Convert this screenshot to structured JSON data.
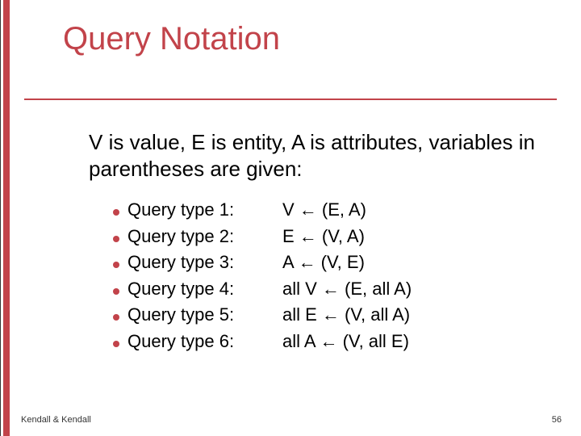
{
  "title": "Query Notation",
  "intro": "V is value, E is entity, A is attributes, variables in parentheses are given:",
  "items": [
    {
      "label": "Query type 1:",
      "expr": "V ← (E, A)"
    },
    {
      "label": "Query type 2:",
      "expr": "E ← (V, A)"
    },
    {
      "label": "Query type 3:",
      "expr": "A ← (V, E)"
    },
    {
      "label": "Query type 4:",
      "expr": "all V ← (E, all A)"
    },
    {
      "label": "Query type 5:",
      "expr": "all E ← (V, all A)"
    },
    {
      "label": "Query type 6:",
      "expr": "all A ← (V, all E)"
    }
  ],
  "footer": {
    "left": "Kendall & Kendall",
    "right": "56"
  },
  "colors": {
    "accent": "#c2434a"
  }
}
